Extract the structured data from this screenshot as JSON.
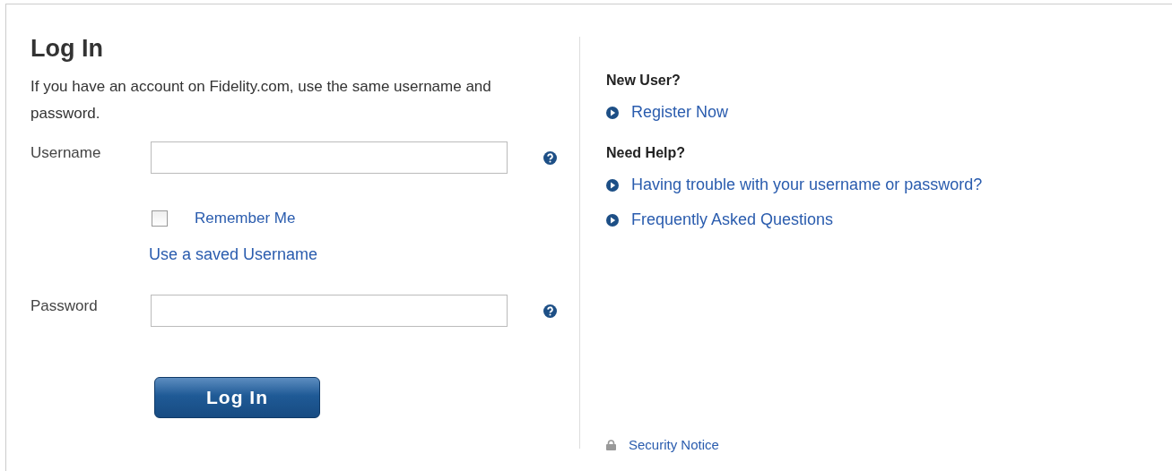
{
  "login": {
    "title": "Log In",
    "intro": "If you have an account on Fidelity.com, use the same username and password.",
    "username": {
      "label": "Username"
    },
    "remember_me": {
      "label": "Remember Me",
      "checked": false
    },
    "saved_username_link": "Use a saved Username",
    "password": {
      "label": "Password"
    },
    "submit_button": "Log In"
  },
  "sidebar": {
    "sections": [
      {
        "heading": "New User?",
        "links": [
          "Register Now"
        ]
      },
      {
        "heading": "Need Help?",
        "links": [
          "Having trouble with your username or password?",
          "Frequently Asked Questions"
        ]
      }
    ],
    "security_notice": "Security Notice"
  }
}
